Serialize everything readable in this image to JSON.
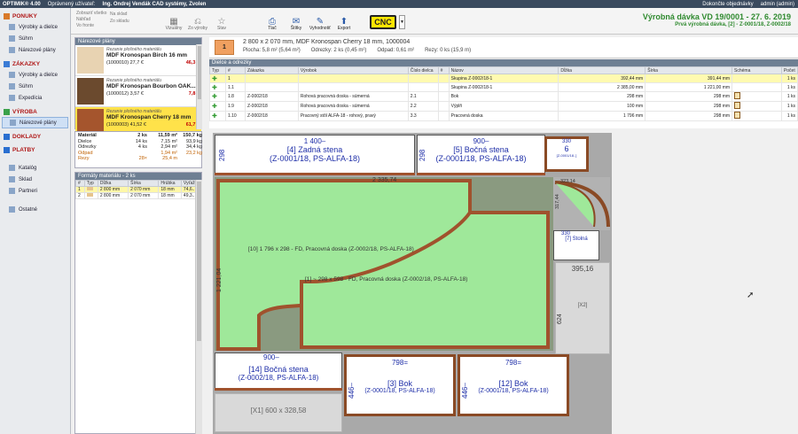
{
  "titlebar": {
    "app": "OPTIMIK® 4.00",
    "user_label": "Oprávnený užívateľ:",
    "user": "Ing. Ondrej Vendák CAD systémy, Zvolen",
    "right1": "Dokončte objednávky",
    "right2": "admin (admin)"
  },
  "sidebar": {
    "sections": [
      {
        "title": "PONUKY",
        "items": [
          {
            "label": "Výrobky a dielce"
          },
          {
            "label": "Súhrn"
          },
          {
            "label": "Nárezové plány"
          }
        ]
      },
      {
        "title": "ZÁKAZKY",
        "items": [
          {
            "label": "Výrobky a dielce"
          },
          {
            "label": "Súhrn"
          },
          {
            "label": "Expedícia"
          }
        ]
      },
      {
        "title": "VÝROBA",
        "items": [
          {
            "label": "Nárezové plány",
            "active": true
          }
        ]
      },
      {
        "title": "DOKLADY",
        "items": []
      },
      {
        "title": "PLATBY",
        "items": []
      },
      {
        "title": "",
        "items": [
          {
            "label": "Katalóg"
          },
          {
            "label": "Sklad"
          },
          {
            "label": "Partneri"
          }
        ]
      },
      {
        "title": "",
        "items": [
          {
            "label": "Ostatné"
          }
        ]
      }
    ]
  },
  "toolbar": {
    "small_left": [
      "Zobraziť všetko",
      "Náhľad",
      "Vo fronte"
    ],
    "small_mid": [
      "Na sklad",
      "Zo skladu"
    ],
    "buttons": [
      {
        "label": "Vizuálny"
      },
      {
        "label": "Zo výroby"
      },
      {
        "label": "Stav"
      },
      {
        "label": "Tlač"
      },
      {
        "label": "Štítky"
      },
      {
        "label": "Vyhodnotiť"
      },
      {
        "label": "Export"
      }
    ],
    "cnc": "CNC"
  },
  "batch": {
    "title": "Výrobná dávka VD 19/0001 - 27. 6. 2019",
    "subtitle": "Prvá výrobná dávka, [2] - Z-0001/18, Z-0002/18"
  },
  "plans_panel": {
    "title": "Nárezové plány",
    "materials": [
      {
        "hint": "Rezanie plošného materiálu",
        "name": "MDF Kronospan Birch 16 mm",
        "count": "(1000010) 27,7 €",
        "price": "46,3 €",
        "color": "#e8d3b2"
      },
      {
        "hint": "Rezanie plošného materiálu",
        "name": "MDF Kronospan Bourbon OAK...",
        "count": "(1000012) 3,57 €",
        "price": "7,8 €",
        "color": "#6b4a2e"
      },
      {
        "hint": "Rezanie plošného materiálu",
        "name": "MDF Kronospan Cherry 18 mm",
        "count": "(1000003) 41,52 €",
        "price": "61,7 €",
        "color": "#a5552d",
        "selected": true
      }
    ]
  },
  "stats": {
    "rows": [
      {
        "label": "Materiál",
        "a": "2 ks",
        "b": "11,59 m²",
        "c": "150,7 kg"
      },
      {
        "label": "Dielce",
        "a": "14 ks",
        "b": "7,15 m²",
        "c": "93,9 kg"
      },
      {
        "label": "Odrezky",
        "a": "4 ks",
        "b": "2,94 m²",
        "c": "34,4 kg"
      },
      {
        "label": "Odpad",
        "a": "",
        "b": "1,94 m²",
        "c": "23,2 kg"
      },
      {
        "label": "Rezy",
        "a": "28×",
        "b": "25,4 m",
        "c": ""
      }
    ]
  },
  "formats_panel": {
    "title": "Formáty materiálu - 2 ks",
    "headers": [
      "#",
      "Typ",
      "Dĺžka",
      "Šírka",
      "Hrúbka",
      "Vyťaž."
    ],
    "rows": [
      {
        "n": "1",
        "typ": "",
        "d": "2 800 mm",
        "s": "2 070 mm",
        "h": "18 mm",
        "v": "74,6..",
        "sel": true
      },
      {
        "n": "2",
        "typ": "",
        "d": "2 800 mm",
        "s": "2 070 mm",
        "h": "18 mm",
        "v": "49,3.."
      }
    ]
  },
  "part_header": {
    "num": "1",
    "line1": "2 800 x 2 070 mm, MDF Kronospan Cherry 18 mm, 1000004",
    "area": "Plocha: 5,8 m² (5,64 m²)",
    "cut": "Odrezky: 2 ks (0,45 m²)",
    "waste": "Odpad: 0,61 m²",
    "cuts": "Rezy: 0 ks (15,9 m)"
  },
  "parts_panel": {
    "title": "Dielce a odrezky",
    "headers": [
      "Typ",
      "#",
      "Zákazka",
      "Výrobok",
      "Číslo dielca",
      "#",
      "Názov",
      "Dĺžka",
      "Šírka",
      "Schéma",
      "Počet"
    ],
    "rows": [
      {
        "typ": "",
        "n": "1",
        "zak": "",
        "vyr": "",
        "cd": "",
        "n2": "",
        "naz": "Skupina Z-0002/18-1",
        "d": "392,44 mm",
        "s": "391,44 mm",
        "sch": "",
        "p": "1 ks",
        "sel": true
      },
      {
        "typ": "",
        "n": "1.1",
        "zak": "",
        "vyr": "",
        "cd": "",
        "n2": "",
        "naz": "Skupina Z-0002/18-1",
        "d": "2 385,00 mm",
        "s": "1 221,00 mm",
        "sch": "",
        "p": "1 ks"
      },
      {
        "typ": "",
        "n": "1.8",
        "zak": "Z-0002/18",
        "vyr": "Rohová pracovná doska - súmerná",
        "cd": "2.1",
        "n2": "",
        "naz": "Bok",
        "d": "298 mm",
        "s": "298 mm",
        "sch": "doc",
        "p": "1 ks"
      },
      {
        "typ": "",
        "n": "1.9",
        "zak": "Z-0002/18",
        "vyr": "Rohová pracovná doska - súmerná",
        "cd": "2.2",
        "n2": "",
        "naz": "Výplň",
        "d": "100 mm",
        "s": "298 mm",
        "sch": "doc",
        "p": "1 ks"
      },
      {
        "typ": "",
        "n": "1.10",
        "zak": "Z-0002/18",
        "vyr": "Pracovný stôl ALFA-18 - rohový, pravý",
        "cd": "3.3",
        "n2": "",
        "naz": "Pracovná doska",
        "d": "1 796 mm",
        "s": "298 mm",
        "sch": "doc",
        "p": "1 ks"
      }
    ]
  },
  "plan": {
    "pieces": [
      {
        "id": "p4",
        "dim": "1 400–",
        "h": "298",
        "name": "[4]  Zadná stena",
        "ref": "(Z-0001/18, PS-ALFA-18)"
      },
      {
        "id": "p5",
        "dim": "900–",
        "h": "298",
        "name": "[5]  Bočná stena",
        "ref": "(Z-0001/18, PS-ALFA-18)"
      },
      {
        "id": "p6",
        "dim": "330",
        "h": "333",
        "name": "6",
        "ref": "[Z-0001/18..]"
      },
      {
        "id": "p14",
        "dim": "900–",
        "h": "446–",
        "name": "[14]  Bočná stena",
        "ref": "(Z-0002/18, PS-ALFA-18)"
      },
      {
        "id": "p3",
        "dim": "798=",
        "h": "446–",
        "name": "[3]  Bok",
        "ref": "(Z-0001/18, PS-ALFA-18)"
      },
      {
        "id": "p12",
        "dim": "798=",
        "h": "446–",
        "name": "[12]  Bok",
        "ref": "(Z-0001/18, PS-ALFA-18)"
      }
    ],
    "desk1": "[10]  1 796 x 298 - FD, Pracovná doska  (Z-0002/18, PS-ALFA-18)",
    "desk2": "[1]  ~ 298 x 598 - FD, Pracovná doska  (Z-0002/18, PS-ALFA-18)",
    "desk_w": "2 335,74",
    "desk_h": "1 221,04",
    "corner_w": "323,14",
    "corner_h": "317,44",
    "small7": "[7] Stolná",
    "small7_dim": "330",
    "x2": "[X2]",
    "x2_w": "395,16",
    "x2_h": "624",
    "x1": "[X1]  600 x 328,58"
  }
}
